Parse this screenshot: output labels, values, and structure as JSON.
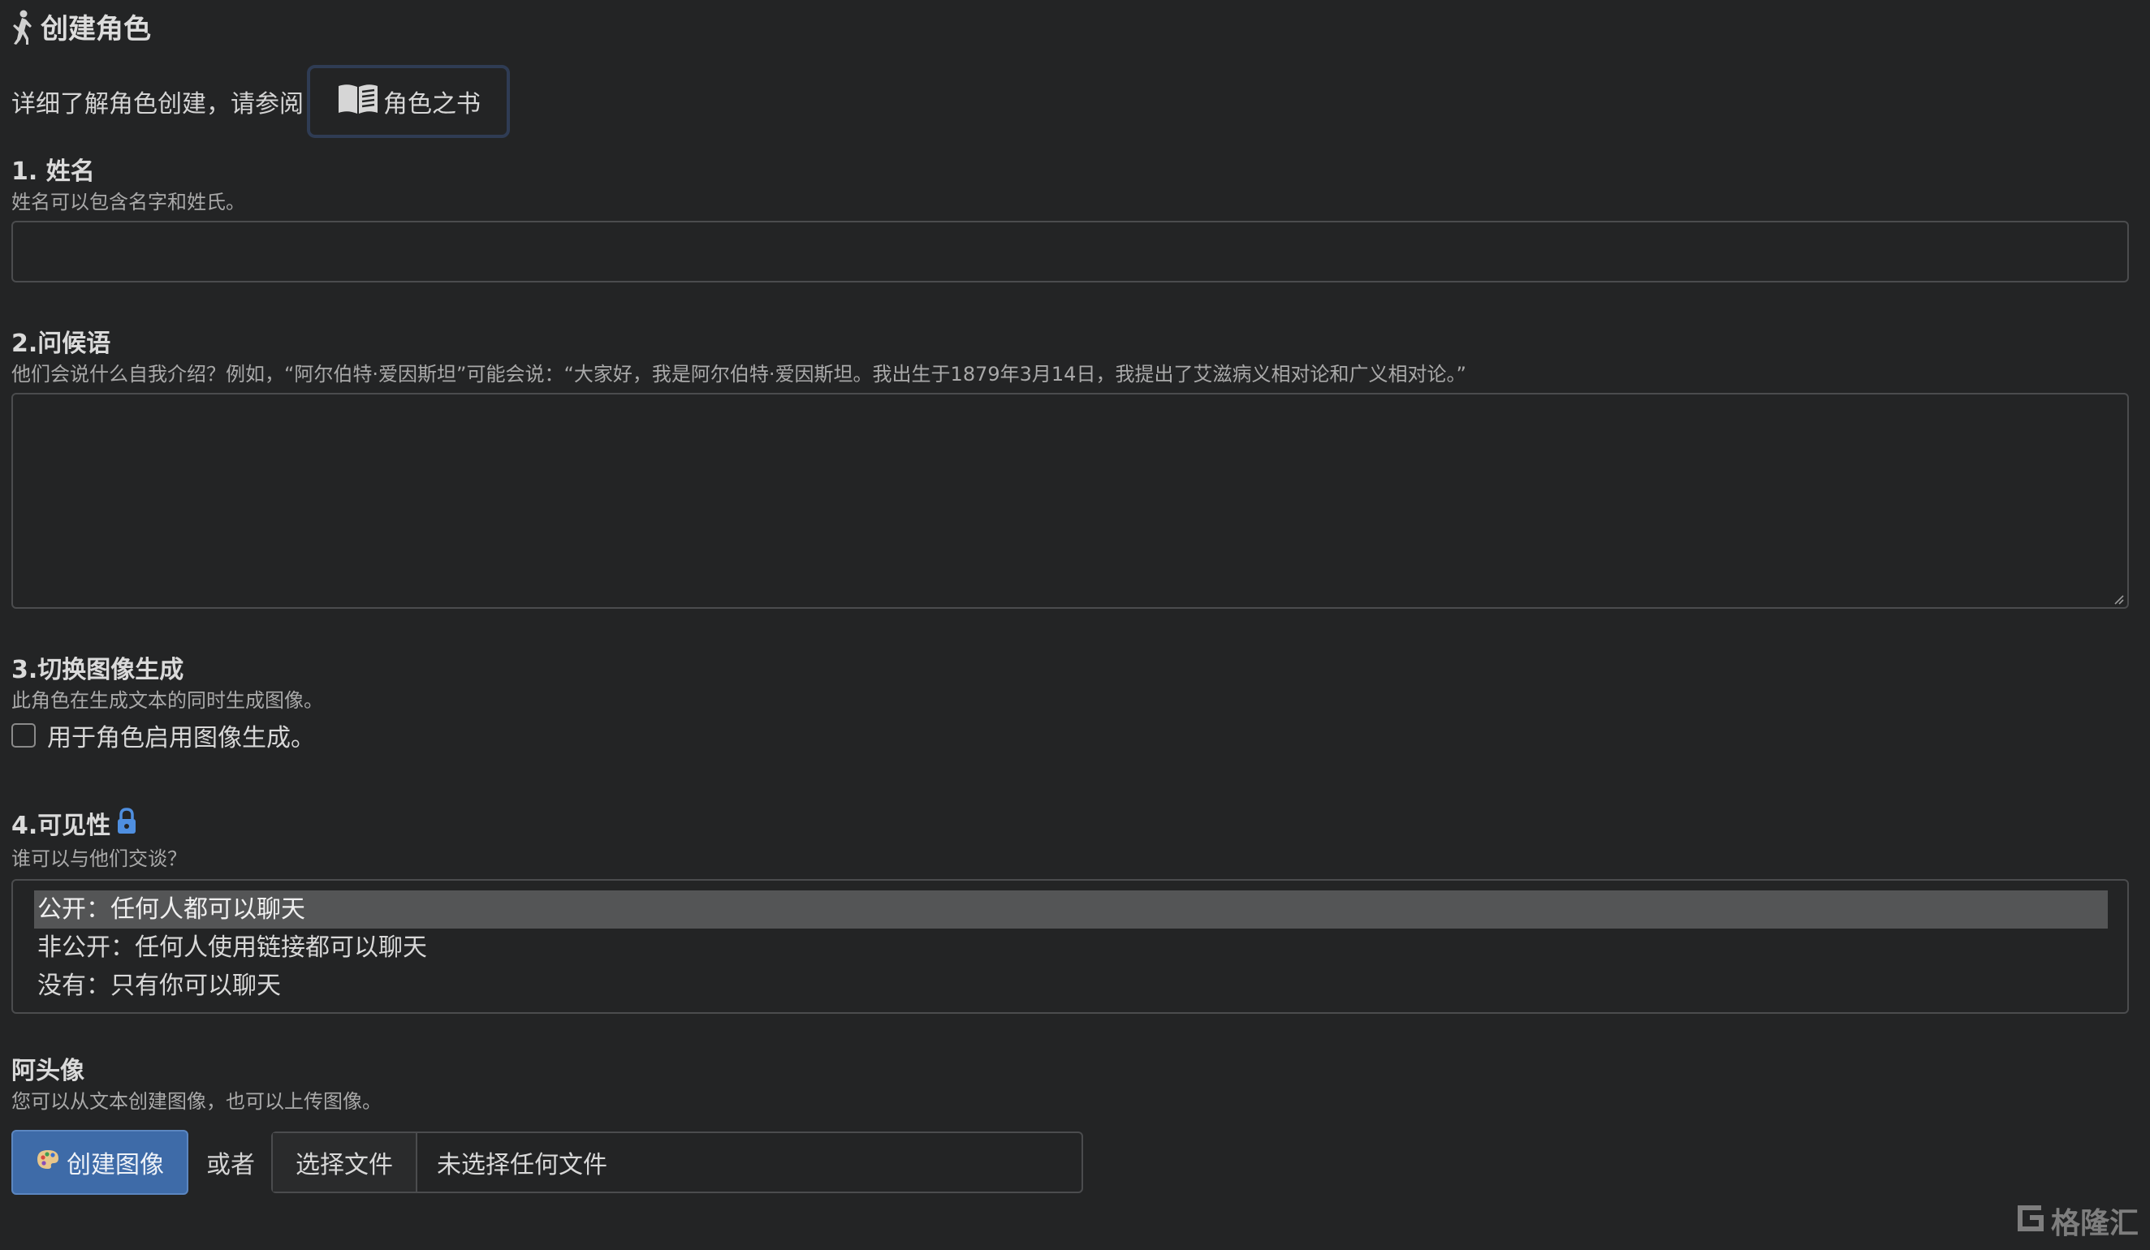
{
  "header": {
    "icon": "dancing-figure-icon",
    "title": "创建角色"
  },
  "intro": {
    "text": "详细了解角色创建，请参阅",
    "guide_button": {
      "icon": "book-icon",
      "label": "角色之书"
    }
  },
  "name_section": {
    "label": "1. 姓名",
    "help": "姓名可以包含名字和姓氏。",
    "value": ""
  },
  "greeting_section": {
    "label": "2.问候语",
    "help": "他们会说什么自我介绍？例如，“阿尔伯特·爱因斯坦”可能会说：“大家好，我是阿尔伯特·爱因斯坦。我出生于1879年3月14日，我提出了艾滋病义相对论和广义相对论。”",
    "value": ""
  },
  "image_gen_section": {
    "label": "3.切换图像生成",
    "help": "此角色在生成文本的同时生成图像。",
    "checkbox_label": "用于角色启用图像生成。",
    "checked": false
  },
  "visibility_section": {
    "label": "4.可见性",
    "icon": "lock-icon",
    "help": "谁可以与他们交谈？",
    "options": [
      "公开：任何人都可以聊天",
      "非公开：任何人使用链接都可以聊天",
      "没有：只有你可以聊天"
    ],
    "selected_index": 0
  },
  "avatar_section": {
    "label": "阿头像",
    "help": "您可以从文本创建图像，也可以上传图像。",
    "create_button": {
      "icon": "palette-icon",
      "label": "创建图像"
    },
    "or_text": "或者",
    "file_input": {
      "button_label": "选择文件",
      "status": "未选择任何文件"
    }
  },
  "watermark": {
    "icon": "gelonghui-logo-icon",
    "text": "格隆汇"
  },
  "colors": {
    "background": "#232425",
    "accent_blue": "#3e6ba8",
    "border": "#4b4c4e",
    "selected_option": "#545556"
  }
}
